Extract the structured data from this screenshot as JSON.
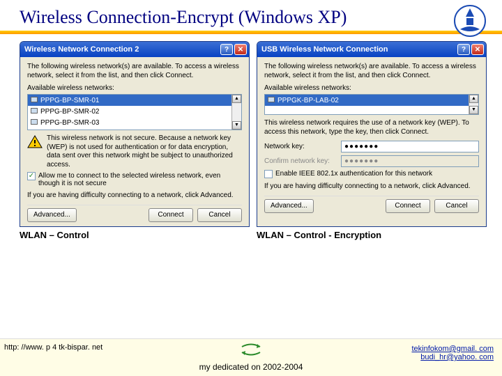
{
  "title": "Wireless Connection-Encrypt (Windows XP)",
  "logo_name": "indonesian-education-logo",
  "dialog1": {
    "title": "Wireless Network Connection 2",
    "intro": "The following wireless network(s) are available. To access a wireless network, select it from the list, and then click Connect.",
    "available_label": "Available wireless networks:",
    "networks": [
      "PPPG-BP-SMR-01",
      "PPPG-BP-SMR-02",
      "PPPG-BP-SMR-03"
    ],
    "warning": "This wireless network is not secure. Because a network key (WEP) is not used for authentication or for data encryption, data sent over this network might be subject to unauthorized access.",
    "allow_check": true,
    "allow_text": "Allow me to connect to the selected wireless network, even though it is not secure",
    "trouble": "If you are having difficulty connecting to a network, click Advanced.",
    "btn_advanced": "Advanced...",
    "btn_connect": "Connect",
    "btn_cancel": "Cancel"
  },
  "dialog2": {
    "title": "USB Wireless Network Connection",
    "intro": "The following wireless network(s) are available. To access a wireless network, select it from the list, and then click Connect.",
    "available_label": "Available wireless networks:",
    "networks": [
      "PPPGK-BP-LAB-02"
    ],
    "requires": "This wireless network requires the use of a network key (WEP). To access this network, type the key, then click Connect.",
    "key_label": "Network key:",
    "key_value": "●●●●●●●",
    "confirm_label": "Confirm network key:",
    "confirm_value": "●●●●●●●",
    "ieee_check": false,
    "ieee_text": "Enable IEEE 802.1x authentication for this network",
    "trouble": "If you are having difficulty connecting to a network, click Advanced.",
    "btn_advanced": "Advanced...",
    "btn_connect": "Connect",
    "btn_cancel": "Cancel"
  },
  "captions": {
    "left": "WLAN – Control",
    "right": "WLAN – Control - Encryption"
  },
  "footer": {
    "url": "http: //www. p 4 tk-bispar. net",
    "email1": "tekinfokom@gmail. com",
    "email2": "budi_hr@yahoo. com",
    "dedication": "my dedicated on 2002-2004"
  },
  "icons": {
    "help": "?",
    "close": "✕",
    "up": "▲",
    "down": "▼",
    "check": "✓"
  }
}
